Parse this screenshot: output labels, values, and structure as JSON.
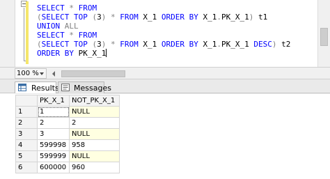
{
  "editor": {
    "lines": [
      [
        {
          "t": "SELECT",
          "c": "kw"
        },
        {
          "t": " ",
          "c": "bk"
        },
        {
          "t": "*",
          "c": "gr"
        },
        {
          "t": " ",
          "c": "bk"
        },
        {
          "t": "FROM",
          "c": "kw"
        }
      ],
      [
        {
          "t": "(",
          "c": "gr"
        },
        {
          "t": "SELECT",
          "c": "kw"
        },
        {
          "t": " ",
          "c": "bk"
        },
        {
          "t": "TOP",
          "c": "kw"
        },
        {
          "t": " ",
          "c": "bk"
        },
        {
          "t": "(",
          "c": "gr"
        },
        {
          "t": "3",
          "c": "bk"
        },
        {
          "t": ")",
          "c": "gr"
        },
        {
          "t": " ",
          "c": "bk"
        },
        {
          "t": "*",
          "c": "gr"
        },
        {
          "t": " ",
          "c": "bk"
        },
        {
          "t": "FROM",
          "c": "kw"
        },
        {
          "t": " X_1 ",
          "c": "bk"
        },
        {
          "t": "ORDER",
          "c": "kw"
        },
        {
          "t": " ",
          "c": "bk"
        },
        {
          "t": "BY",
          "c": "kw"
        },
        {
          "t": " X_1",
          "c": "bk"
        },
        {
          "t": ".",
          "c": "gr"
        },
        {
          "t": "PK_X_1",
          "c": "bk"
        },
        {
          "t": ")",
          "c": "gr"
        },
        {
          "t": " t1",
          "c": "bk"
        }
      ],
      [
        {
          "t": "UNION",
          "c": "kw"
        },
        {
          "t": " ",
          "c": "bk"
        },
        {
          "t": "ALL",
          "c": "gr"
        }
      ],
      [
        {
          "t": "SELECT",
          "c": "kw"
        },
        {
          "t": " ",
          "c": "bk"
        },
        {
          "t": "*",
          "c": "gr"
        },
        {
          "t": " ",
          "c": "bk"
        },
        {
          "t": "FROM",
          "c": "kw"
        }
      ],
      [
        {
          "t": "(",
          "c": "gr"
        },
        {
          "t": "SELECT",
          "c": "kw"
        },
        {
          "t": " ",
          "c": "bk"
        },
        {
          "t": "TOP",
          "c": "kw"
        },
        {
          "t": " ",
          "c": "bk"
        },
        {
          "t": "(",
          "c": "gr"
        },
        {
          "t": "3",
          "c": "bk"
        },
        {
          "t": ")",
          "c": "gr"
        },
        {
          "t": " ",
          "c": "bk"
        },
        {
          "t": "*",
          "c": "gr"
        },
        {
          "t": " ",
          "c": "bk"
        },
        {
          "t": "FROM",
          "c": "kw"
        },
        {
          "t": " X_1 ",
          "c": "bk"
        },
        {
          "t": "ORDER",
          "c": "kw"
        },
        {
          "t": " ",
          "c": "bk"
        },
        {
          "t": "BY",
          "c": "kw"
        },
        {
          "t": " X_1",
          "c": "bk"
        },
        {
          "t": ".",
          "c": "gr"
        },
        {
          "t": "PK_X_1",
          "c": "bk"
        },
        {
          "t": " ",
          "c": "bk"
        },
        {
          "t": "DESC",
          "c": "kw"
        },
        {
          "t": ")",
          "c": "gr"
        },
        {
          "t": " t2",
          "c": "bk"
        }
      ],
      [
        {
          "t": "ORDER",
          "c": "kw"
        },
        {
          "t": " ",
          "c": "bk"
        },
        {
          "t": "BY",
          "c": "kw"
        },
        {
          "t": " PK_X_1",
          "c": "bk"
        }
      ]
    ]
  },
  "status": {
    "zoom": "100 %"
  },
  "tabs": {
    "results": "Results",
    "messages": "Messages"
  },
  "grid": {
    "columns": [
      "PK_X_1",
      "NOT_PK_X_1"
    ],
    "rows": [
      {
        "n": "1",
        "pk": "1",
        "notpk": "NULL"
      },
      {
        "n": "2",
        "pk": "2",
        "notpk": "2"
      },
      {
        "n": "3",
        "pk": "3",
        "notpk": "NULL"
      },
      {
        "n": "4",
        "pk": "599998",
        "notpk": "958"
      },
      {
        "n": "5",
        "pk": "599999",
        "notpk": "NULL"
      },
      {
        "n": "6",
        "pk": "600000",
        "notpk": "960"
      }
    ]
  },
  "colors": {
    "keyword": "#0000ff",
    "operator": "#808080",
    "null_cell": "#ffffe1"
  }
}
